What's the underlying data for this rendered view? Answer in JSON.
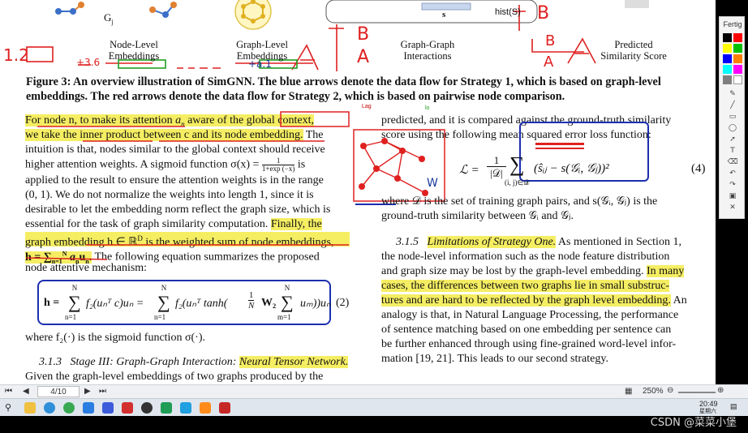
{
  "figure": {
    "top_labels": {
      "gi": "G",
      "gi_sub": "j",
      "s": "s",
      "hist": "hist(S)"
    },
    "labels": {
      "node_level": "Node-Level\nEmbeddings",
      "graph_level": "Graph-Level\nEmbeddings",
      "graph_graph": "Graph-Graph\nInteractions",
      "predicted": "Predicted\nSimilarity Score"
    },
    "caption": "Figure 3: An overview illustration of SimGNN. The blue arrows denote the data flow for Strategy 1, which is based on graph-level embeddings. The red arrows denote the data flow for Strategy 2, which is based on pairwise node comparison."
  },
  "left_column": {
    "para1": {
      "l1_hl": "For node n, to make its attention",
      "l1_a": " a",
      "l1_a_sub": "n",
      "l1_mid": " aware of the ",
      "l1_gc": "global context,",
      "l2_hl": "we take the inner product between c and its node embedding.",
      "l2_rest": " The",
      "l3": "intuition is that, nodes similar to the global context should receive",
      "l4a": "higher attention weights. A sigmoid function σ(x) = ",
      "l4_num": "1",
      "l4_den": "1+exp (−x)",
      "l4b": " is",
      "l5": "applied to the result to ensure the attention weights is in the range",
      "l6": "(0, 1). We do not normalize the weights into length 1, since it is",
      "l7": "desirable to let the embedding norm reflect the graph size, which is",
      "l8a": "essential for the task of graph similarity computation. ",
      "l8_hl": "Finally, the",
      "l9_hl": "graph embedding h ∈ ℝ",
      "l9_sup": "D",
      "l9_hl2": " is the weighted sum of node embeddings,",
      "l10_hl": "h = ∑",
      "l10_sub": "n=1",
      "l10_sup": "N",
      "l10_hl2": " a",
      "l10_sub2": "n",
      "l10_hl3": "u",
      "l10_sub3": "n",
      "l10_hl4": ".",
      "l10_rest": " The following equation summarizes the proposed",
      "l11": "node attentive mechanism:"
    },
    "equation2": {
      "lhs": "h =",
      "sum1_top": "N",
      "sum1_bot": "n=1",
      "term1": "f₂(uₙᵀ c)uₙ =",
      "sum2_top": "N",
      "sum2_bot": "n=1",
      "term2a": "f₂(uₙᵀ tanh(",
      "frac_num": "1",
      "frac_den": "N",
      "term2b": "W₂",
      "sum3_top": "N",
      "sum3_bot": "m=1",
      "term2c": "uₘ))uₙ",
      "number": "(2)"
    },
    "after_eq": "where f₂(·) is the sigmoid function σ(·).",
    "section_num": "3.1.3",
    "section_title": "Stage III: Graph-Graph Interaction: ",
    "section_title_hl": "Neural Tensor Network.",
    "last_line": "Given the graph-level embeddings of two graphs produced by the"
  },
  "right_column": {
    "r1": "predicted, and it is compared against the ground-truth similarity",
    "r2": "score using the following mean squared error loss function:",
    "eq4": {
      "lhs": "ℒ =",
      "num": "1",
      "den": "|𝒟|",
      "sum_bot": "(i, j)∈𝒟",
      "body": "(ŝᵢⱼ − s(𝒢ᵢ, 𝒢ⱼ))²",
      "number": "(4)"
    },
    "r3": "where 𝒟 is the set of training graph pairs, and s(𝒢ᵢ, 𝒢ⱼ) is the",
    "r4": "ground-truth similarity between 𝒢ᵢ and 𝒢ⱼ.",
    "section_num": "3.1.5",
    "section_title_hl": "Limitations of Strategy One.",
    "p1": " As mentioned in Section 1,",
    "p2": "the node-level information such as the node feature distribution",
    "p3": "and graph size may be lost by the graph-level embedding. ",
    "p3_hl": "In many",
    "p4_hl": "cases, the differences between two graphs lie in small substruc-",
    "p5_hl": "tures and are hard to be reflected by the graph level embedding.",
    "p5_rest": " An",
    "p6": "analogy is that, in Natural Language Processing, the performance",
    "p7": "of sentence matching based on one embedding per sentence can",
    "p8": "be further enhanced through using fine-grained word-level infor-",
    "p9": "mation [19, 21]. This leads to our second strategy."
  },
  "annotations": {
    "n12": "1.2",
    "n36": "+3.6",
    "n41": "+a.1",
    "b1": "B",
    "a1": "A",
    "b2": "B",
    "a2": "A",
    "b3": "B",
    "a3": "A",
    "tag1": "Lag",
    "tag2": "lo",
    "tag3": "Wu",
    "tag4": "Wu",
    "tag5": "Gj"
  },
  "palette": {
    "title": "Fertig",
    "colors": [
      "#000000",
      "#ff0000",
      "#ffff00",
      "#00c000",
      "#0000ff",
      "#ff8000",
      "#00ffff",
      "#ff00ff",
      "#808080",
      "#ffffff"
    ]
  },
  "statusbar": {
    "page": "4/10",
    "zoom": "250%"
  },
  "taskbar": {
    "time": "20:49",
    "day": "星期六"
  },
  "watermark": "CSDN @菜菜小堡"
}
